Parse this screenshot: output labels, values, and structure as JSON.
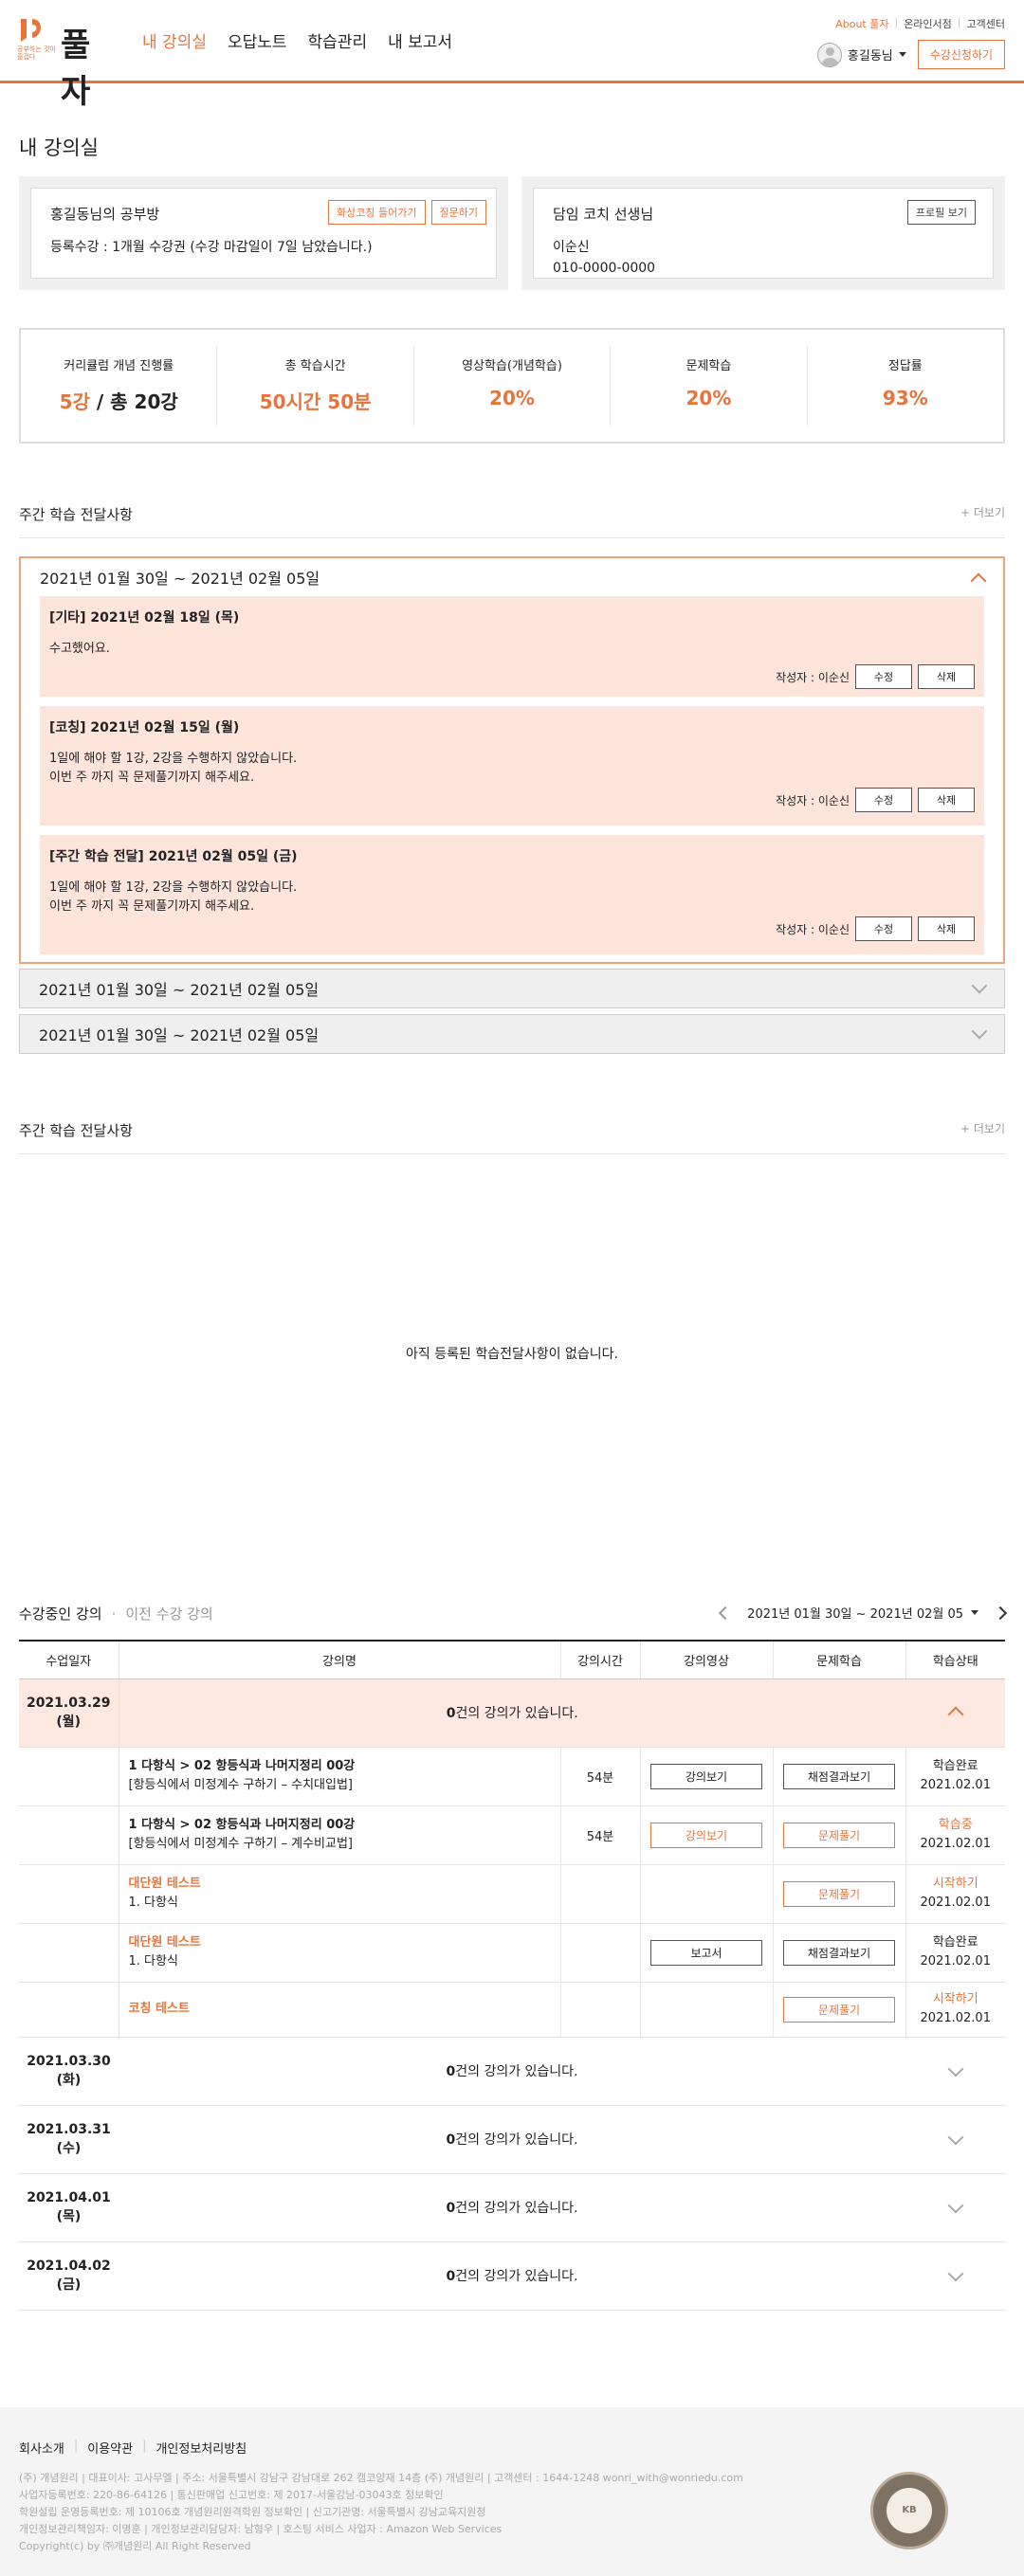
{
  "header": {
    "logo_text": "풀자",
    "logo_sub": "공부하는 것이 즐겁다",
    "nav": [
      "내 강의실",
      "오답노트",
      "학습관리",
      "내 보고서"
    ],
    "util": [
      "About 풀자",
      "온라인서점",
      "고객센터"
    ],
    "user_name": "홍길동님",
    "apply_btn": "수강신청하기"
  },
  "page_title": "내 강의실",
  "study_card": {
    "title": "홍길동님의 공부방",
    "btn_coaching": "화상코칭 들어가기",
    "btn_question": "질문하기",
    "text": "등록수강 : 1개월 수강권 (수강 마감일이 7일 남았습니다.)"
  },
  "coach_card": {
    "title": "담임 코치 선생님",
    "btn_profile": "프로필 보기",
    "name": "이순신",
    "phone": "010-0000-0000"
  },
  "stats": [
    {
      "label": "커리큘럼 개념 진행률",
      "v1": "5강",
      "v2": " / 총 20강"
    },
    {
      "label": "총 학습시간",
      "v1": "50시간 50분",
      "v2": ""
    },
    {
      "label": "영상학습(개념학습)",
      "v1": "20%",
      "v2": ""
    },
    {
      "label": "문제학습",
      "v1": "20%",
      "v2": ""
    },
    {
      "label": "정답률",
      "v1": "93%",
      "v2": ""
    }
  ],
  "weekly": {
    "title": "주간 학습 전달사항",
    "more": "+ 더보기",
    "open_period": "2021년 01월 30일 ~ 2021년 02월 05일",
    "notices": [
      {
        "title": "[기타] 2021년 02월 18일 (목)",
        "body1": "수고했어요.",
        "body2": ""
      },
      {
        "title": "[코칭] 2021년 02월 15일 (월)",
        "body1": "1일에 해야 할 1강, 2강을 수행하지 않았습니다.",
        "body2": "이번 주 까지 꼭 문제풀기까지 해주세요."
      },
      {
        "title": "[주간 학습 전달] 2021년 02월 05일 (금)",
        "body1": "1일에 해야 할 1강, 2강을 수행하지 않았습니다.",
        "body2": "이번 주 까지 꼭 문제풀기까지 해주세요."
      }
    ],
    "writer": "작성자 : 이순신",
    "edit": "수정",
    "delete": "삭제",
    "closed_periods": [
      "2021년 01월 30일 ~ 2021년 02월 05일",
      "2021년 01월 30일 ~ 2021년 02월 05일"
    ]
  },
  "weekly2": {
    "title": "주간 학습 전달사항",
    "more": "+ 더보기",
    "empty": "아직 등록된 학습전달사항이 없습니다."
  },
  "courses": {
    "tab_active": "수강중인 강의",
    "tab_inactive": "이전 수강 강의",
    "range": "2021년 01월 30일 ~ 2021년 02월 05",
    "headers": [
      "수업일자",
      "강의명",
      "강의시간",
      "강의영상",
      "문제학습",
      "학습상태"
    ],
    "day1": {
      "date": "2021.03.29",
      "dow": "(월)",
      "count": "0",
      "count_suffix": "건의 강의가 있습니다."
    },
    "rows": [
      {
        "t1": "1 다항식 > 02 항등식과 나머지정리 00강",
        "t2": "[항등식에서 미정계수 구하기 – 수치대입법]",
        "time": "54분",
        "video": "강의보기",
        "prob": "채점결과보기",
        "st": "학습완료",
        "sd": "2021.02.01"
      },
      {
        "t1": "1 다항식 > 02 항등식과 나머지정리 00강",
        "t2": "[항등식에서 미정계수 구하기 – 계수비교법]",
        "time": "54분",
        "video": "강의보기",
        "prob": "문제풀기",
        "st": "학습중",
        "sd": "2021.02.01"
      },
      {
        "t1": "대단원 테스트",
        "t2": "1. 다항식",
        "time": "",
        "video": "",
        "prob": "문제풀기",
        "st": "시작하기",
        "sd": "2021.02.01"
      },
      {
        "t1": "대단원 테스트",
        "t2": "1. 다항식",
        "time": "",
        "video": "보고서",
        "prob": "채점결과보기",
        "st": "학습완료",
        "sd": "2021.02.01"
      },
      {
        "t1": "코칭 테스트",
        "t2": "",
        "time": "",
        "video": "",
        "prob": "문제풀기",
        "st": "시작하기",
        "sd": "2021.02.01"
      }
    ],
    "days": [
      {
        "date": "2021.03.30",
        "dow": "(화)"
      },
      {
        "date": "2021.03.31",
        "dow": "(수)"
      },
      {
        "date": "2021.04.01",
        "dow": "(목)"
      },
      {
        "date": "2021.04.02",
        "dow": "(금)"
      }
    ]
  },
  "footer": {
    "links": [
      "회사소개",
      "이용약관",
      "개인정보처리방침"
    ],
    "info": [
      "(주) 개념원리 | 대표이사: 고사무엘 | 주소: 서울특별시 강남구 강남대로 262 캠코양재 14층 (주) 개념원리 | 고객센터 : 1644-1248  wonri_with@wonriedu.com",
      "사업자등록번호: 220-86-64126 | 통신판매업 신고번호: 제 2017-서울강남-03043호 정보확인",
      "학원설립 운영등록번호: 제 10106호 개념원리원격학원 정보확인 | 신고기관명: 서울특별시 강남교육지원청",
      "개인정보관리책임자: 이명훈 | 개인정보관리담당자: 남형우 | 호스팅 서비스 사업자 : Amazon Web Services",
      "Copyright(c) by ㈜개념원리 All Right Reserved"
    ],
    "badge": "KB"
  }
}
